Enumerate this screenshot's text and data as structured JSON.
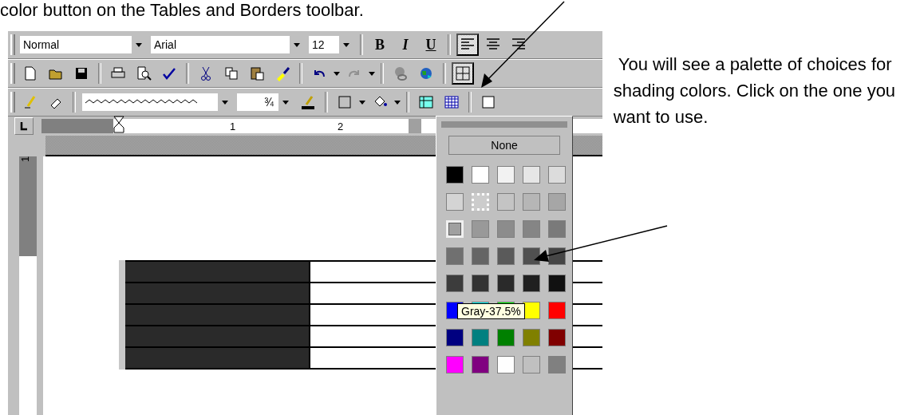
{
  "caption_top": "color button on the Tables and Borders toolbar.",
  "formatting_toolbar": {
    "style": "Normal",
    "font": "Arial",
    "size": "12",
    "format_buttons": [
      "B",
      "I",
      "U"
    ],
    "align_buttons": [
      {
        "pressed": true
      },
      {
        "pressed": false
      },
      {
        "pressed": false
      }
    ]
  },
  "standard_toolbar": {
    "tables_and_borders_button": {
      "pressed": true
    }
  },
  "tables_borders_toolbar": {
    "line_weight": "¾"
  },
  "ruler": {
    "labels": [
      "1",
      "2"
    ],
    "vertical_label": "1"
  },
  "palette": {
    "none_label": "None",
    "tooltip": "Gray-37.5%",
    "swatches": [
      {
        "color": "#000000",
        "selected": false,
        "hovered": false
      },
      {
        "color": "#ffffff",
        "selected": false,
        "hovered": false
      },
      {
        "color": "#f2f2f2",
        "selected": false,
        "hovered": false
      },
      {
        "color": "#e6e6e6",
        "selected": false,
        "hovered": false
      },
      {
        "color": "#dcdcdc",
        "selected": false,
        "hovered": false
      },
      {
        "color": "#d4d4d4",
        "selected": false,
        "hovered": false
      },
      {
        "color": "#cccccc",
        "selected": true,
        "hovered": false
      },
      {
        "color": "#c4c4c4",
        "selected": false,
        "hovered": false
      },
      {
        "color": "#b6b6b6",
        "selected": false,
        "hovered": false
      },
      {
        "color": "#a6a6a6",
        "selected": false,
        "hovered": false
      },
      {
        "color": "#a0a0a0",
        "selected": false,
        "hovered": true
      },
      {
        "color": "#999999",
        "selected": false,
        "hovered": false
      },
      {
        "color": "#8c8c8c",
        "selected": false,
        "hovered": false
      },
      {
        "color": "#858585",
        "selected": false,
        "hovered": false
      },
      {
        "color": "#7a7a7a",
        "selected": false,
        "hovered": false
      },
      {
        "color": "#707070",
        "selected": false,
        "hovered": false
      },
      {
        "color": "#656565",
        "selected": false,
        "hovered": false
      },
      {
        "color": "#5a5a5a",
        "selected": false,
        "hovered": false
      },
      {
        "color": "#505050",
        "selected": false,
        "hovered": false
      },
      {
        "color": "#464646",
        "selected": false,
        "hovered": false
      },
      {
        "color": "#3c3c3c",
        "selected": false,
        "hovered": false
      },
      {
        "color": "#333333",
        "selected": false,
        "hovered": false
      },
      {
        "color": "#2a2a2a",
        "selected": false,
        "hovered": false
      },
      {
        "color": "#202020",
        "selected": false,
        "hovered": false
      },
      {
        "color": "#111111",
        "selected": false,
        "hovered": false
      },
      {
        "color": "#0000ff",
        "selected": false,
        "hovered": false
      },
      {
        "color": "#00ffff",
        "selected": false,
        "hovered": false
      },
      {
        "color": "#00ff00",
        "selected": false,
        "hovered": false
      },
      {
        "color": "#ffff00",
        "selected": false,
        "hovered": false
      },
      {
        "color": "#ff0000",
        "selected": false,
        "hovered": false
      },
      {
        "color": "#000080",
        "selected": false,
        "hovered": false
      },
      {
        "color": "#008080",
        "selected": false,
        "hovered": false
      },
      {
        "color": "#008000",
        "selected": false,
        "hovered": false
      },
      {
        "color": "#808000",
        "selected": false,
        "hovered": false
      },
      {
        "color": "#800000",
        "selected": false,
        "hovered": false
      },
      {
        "color": "#ff00ff",
        "selected": false,
        "hovered": false
      },
      {
        "color": "#800080",
        "selected": false,
        "hovered": false
      },
      {
        "color": "#fefefe",
        "selected": false,
        "hovered": false
      },
      {
        "color": "#c0c0c0",
        "selected": false,
        "hovered": false
      },
      {
        "color": "#808080",
        "selected": false,
        "hovered": false
      }
    ]
  },
  "table": {
    "rows": [
      {
        "shaded": true
      },
      {
        "shaded": true
      },
      {
        "shaded": true
      },
      {
        "shaded": true
      },
      {
        "shaded": true
      }
    ]
  },
  "note": " You will see a palette of choices for shading colors. Click on the one you want to use."
}
